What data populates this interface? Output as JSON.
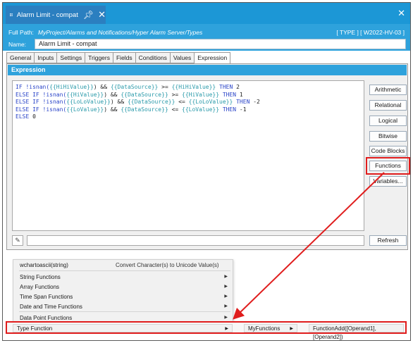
{
  "window": {
    "title": "Alarm Limit - compat",
    "full_path_label": "Full Path:",
    "full_path_value": "MyProject/Alarms and Notifications/Hyper Alarm Server/Types",
    "type_badge": "[ TYPE ] [ W2022-HV-03 ]",
    "name_label": "Name:",
    "name_value": "Alarm Limit - compat"
  },
  "tabs": [
    "General",
    "Inputs",
    "Settings",
    "Triggers",
    "Fields",
    "Conditions",
    "Values",
    "Expression"
  ],
  "active_tab": "Expression",
  "panel": {
    "title": "Expression"
  },
  "expression_lines": [
    [
      {
        "t": "IF ",
        "c": "kw"
      },
      {
        "t": "!isnan(",
        "c": "kw"
      },
      {
        "t": "{{HiHiValue}}",
        "c": "var"
      },
      {
        "t": ") && ",
        "c": "op"
      },
      {
        "t": "{{DataSource}}",
        "c": "var"
      },
      {
        "t": " >= ",
        "c": "op"
      },
      {
        "t": "{{HiHiValue}}",
        "c": "var"
      },
      {
        "t": " THEN ",
        "c": "kw"
      },
      {
        "t": "2",
        "c": "num"
      }
    ],
    [
      {
        "t": "ELSE IF ",
        "c": "kw"
      },
      {
        "t": "!isnan(",
        "c": "kw"
      },
      {
        "t": "{{HiValue}}",
        "c": "var"
      },
      {
        "t": ") && ",
        "c": "op"
      },
      {
        "t": "{{DataSource}}",
        "c": "var"
      },
      {
        "t": " >= ",
        "c": "op"
      },
      {
        "t": "{{HiValue}}",
        "c": "var"
      },
      {
        "t": " THEN ",
        "c": "kw"
      },
      {
        "t": "1",
        "c": "num"
      }
    ],
    [
      {
        "t": "ELSE IF ",
        "c": "kw"
      },
      {
        "t": "!isnan(",
        "c": "kw"
      },
      {
        "t": "{{LoLoValue}}",
        "c": "var"
      },
      {
        "t": ") && ",
        "c": "op"
      },
      {
        "t": "{{DataSource}}",
        "c": "var"
      },
      {
        "t": " <= ",
        "c": "op"
      },
      {
        "t": "{{LoLoValue}}",
        "c": "var"
      },
      {
        "t": " THEN ",
        "c": "kw"
      },
      {
        "t": "-2",
        "c": "num"
      }
    ],
    [
      {
        "t": "ELSE IF ",
        "c": "kw"
      },
      {
        "t": "!isnan(",
        "c": "kw"
      },
      {
        "t": "{{LoValue}}",
        "c": "var"
      },
      {
        "t": ") && ",
        "c": "op"
      },
      {
        "t": "{{DataSource}}",
        "c": "var"
      },
      {
        "t": " <= ",
        "c": "op"
      },
      {
        "t": "{{LoValue}}",
        "c": "var"
      },
      {
        "t": " THEN ",
        "c": "kw"
      },
      {
        "t": "-1",
        "c": "num"
      }
    ],
    [
      {
        "t": "ELSE ",
        "c": "kw"
      },
      {
        "t": "0",
        "c": "num"
      }
    ]
  ],
  "side_buttons": {
    "arithmetic": "Arithmetic",
    "relational": "Relational",
    "logical": "Logical",
    "bitwise": "Bitwise",
    "code_blocks": "Code Blocks",
    "functions": "Functions",
    "variables": "Variables...",
    "refresh": "Refresh"
  },
  "menu": {
    "top_item": "wchartoascii(string)",
    "top_item_desc": "Convert Character(s) to Unicode Value(s)",
    "string_functions": "String Functions",
    "array_functions": "Array Functions",
    "time_span_functions": "Time Span Functions",
    "date_time_functions": "Date and Time Functions",
    "data_point_functions": "Data Point Functions",
    "type_function": "Type Function",
    "my_functions": "MyFunctions",
    "function_add": "FunctionAdd([Operand1], [Operand2])"
  },
  "colors": {
    "title_blue": "#1c97d6",
    "header_blue": "#2ea2dc",
    "highlight_red": "#e01d1d",
    "keyword": "#2a44c8",
    "variable": "#2a9aaa"
  },
  "icons": [
    "grid-icon",
    "pin-icon",
    "close-icon",
    "edit-icon",
    "chevron-right-icon"
  ]
}
